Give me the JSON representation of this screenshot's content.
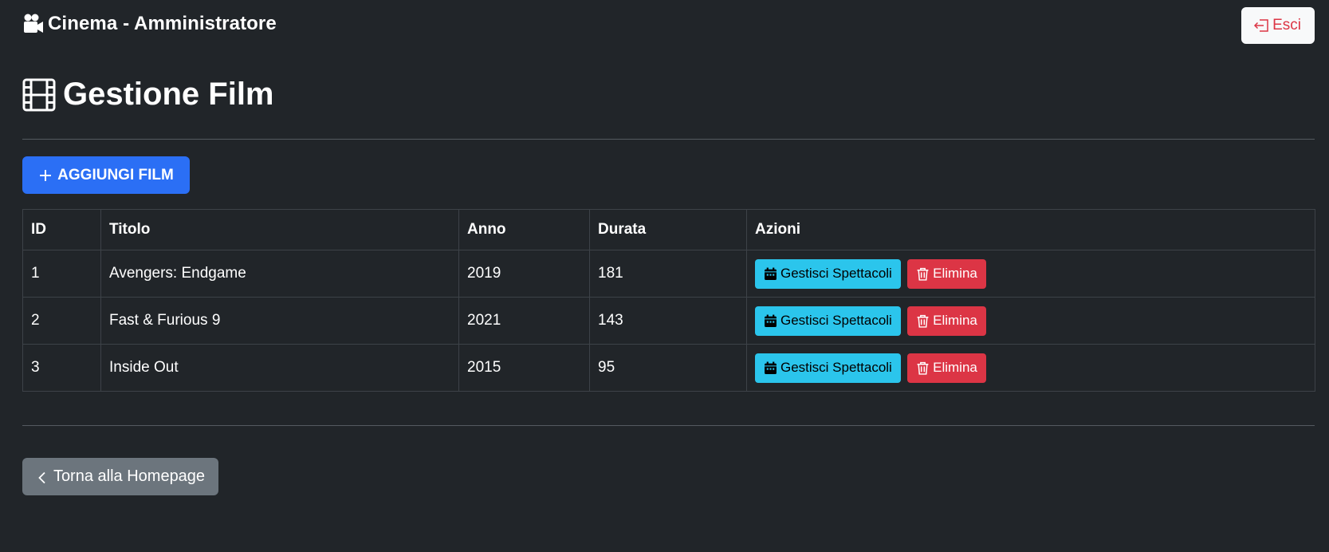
{
  "navbar": {
    "brand_icon": "video-camera-icon",
    "brand": "Cinema - Amministratore",
    "logout_icon": "box-arrow-left-icon",
    "logout_label": "Esci"
  },
  "main": {
    "title_icon": "film-icon",
    "title": "Gestione Film",
    "add_button": {
      "icon": "plus-icon",
      "label": "AGGIUNGI FILM"
    },
    "table": {
      "headers": [
        "ID",
        "Titolo",
        "Anno",
        "Durata",
        "Azioni"
      ],
      "rows": [
        {
          "id": "1",
          "titolo": "Avengers: Endgame",
          "anno": "2019",
          "durata": "181"
        },
        {
          "id": "2",
          "titolo": "Fast & Furious 9",
          "anno": "2021",
          "durata": "143"
        },
        {
          "id": "3",
          "titolo": "Inside Out",
          "anno": "2015",
          "durata": "95"
        }
      ],
      "actions": {
        "manage_icon": "calendar-icon",
        "manage_label": "Gestisci Spettacoli",
        "delete_icon": "trash-icon",
        "delete_label": "Elimina"
      }
    },
    "back_button": {
      "icon": "chevron-left-icon",
      "label": "Torna alla Homepage"
    }
  },
  "colors": {
    "background": "#212529",
    "primary": "#2b6ff5",
    "info": "#2bc5ec",
    "danger": "#dc3545",
    "secondary": "#6c757d",
    "light": "#f8f9fa"
  }
}
